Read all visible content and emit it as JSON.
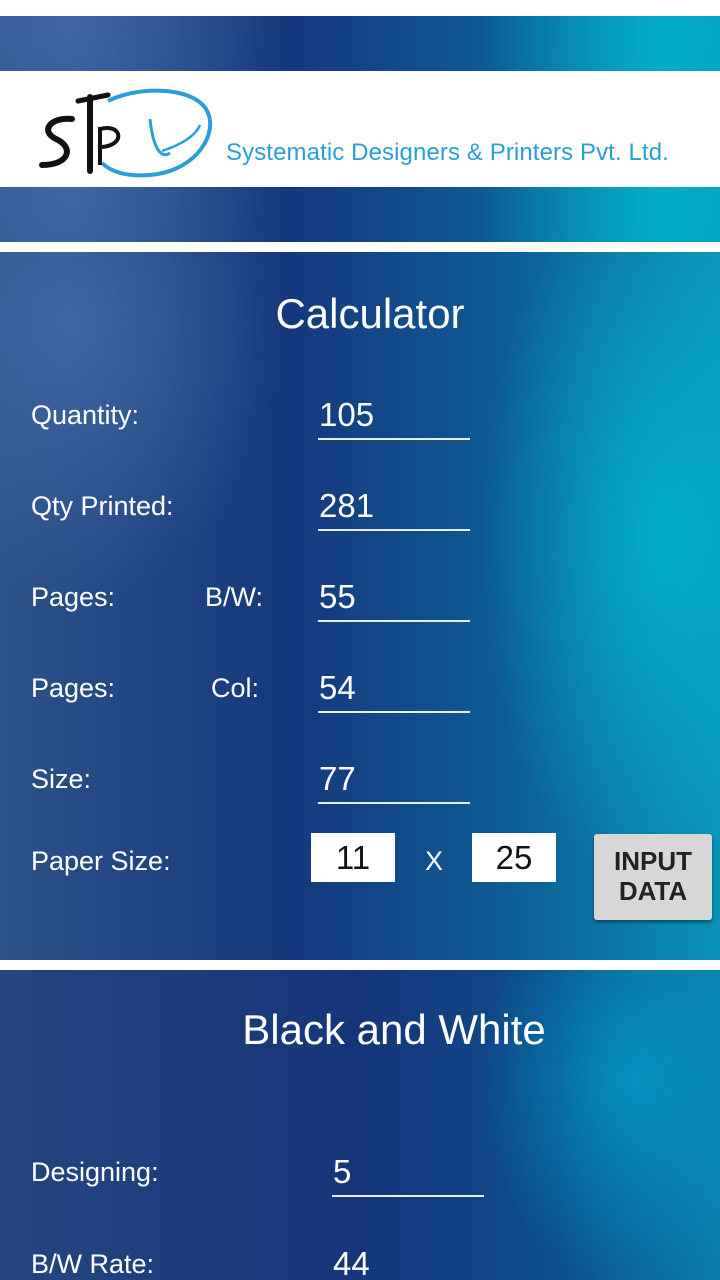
{
  "header": {
    "logo_letters": "SPL",
    "company_name": "Systematic Designers & Printers Pvt. Ltd."
  },
  "calculator": {
    "title": "Calculator",
    "fields": {
      "quantity": {
        "label": "Quantity:",
        "value": "105"
      },
      "qty_printed": {
        "label": "Qty Printed:",
        "value": "281"
      },
      "pages_bw": {
        "label": "Pages:",
        "sublabel": "B/W:",
        "value": "55"
      },
      "pages_col": {
        "label": "Pages:",
        "sublabel": "Col:",
        "value": "54"
      },
      "size": {
        "label": "Size:",
        "value": "77"
      },
      "paper_size": {
        "label": "Paper Size:",
        "width": "11",
        "separator": "X",
        "height": "25"
      }
    },
    "input_data_button": "INPUT DATA"
  },
  "black_and_white": {
    "title": "Black and White",
    "fields": {
      "designing": {
        "label": "Designing:",
        "value": "5"
      },
      "bw_rate": {
        "label": "B/W Rate:",
        "value": "44"
      }
    }
  },
  "colors": {
    "logo_blue": "#2a9fd6",
    "field_underline": "#e8eef6",
    "button_bg": "#d7d7d7"
  }
}
